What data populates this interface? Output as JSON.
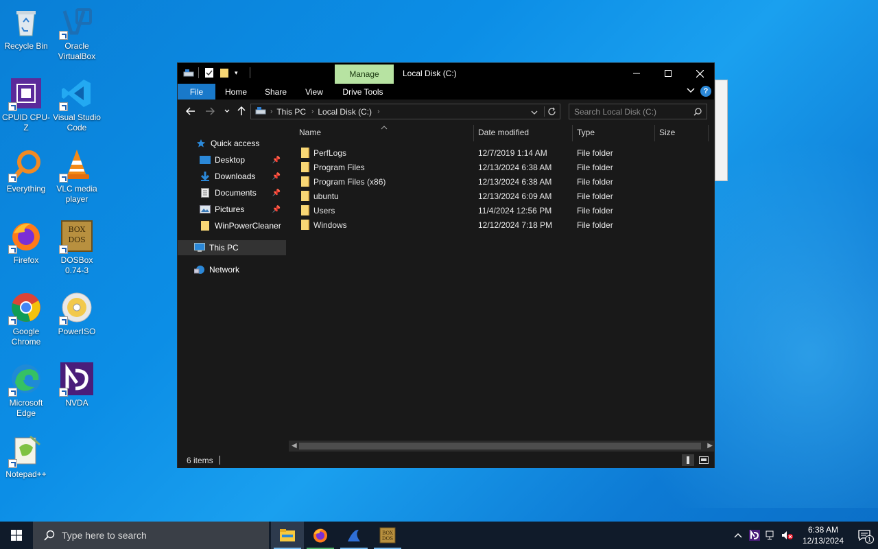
{
  "desktop": {
    "icons": [
      {
        "label": "Recycle Bin"
      },
      {
        "label": "Oracle VirtualBox"
      },
      {
        "label": "CPUID CPU-Z"
      },
      {
        "label": "Visual Studio Code"
      },
      {
        "label": "Everything"
      },
      {
        "label": "VLC media player"
      },
      {
        "label": "Firefox"
      },
      {
        "label": "DOSBox 0.74-3"
      },
      {
        "label": "Google Chrome"
      },
      {
        "label": "PowerISO"
      },
      {
        "label": "Microsoft Edge"
      },
      {
        "label": "NVDA"
      },
      {
        "label": "Notepad++"
      }
    ]
  },
  "window": {
    "title": "Local Disk (C:)",
    "manage_tab": "Manage",
    "ribbon_tabs": [
      "File",
      "Home",
      "Share",
      "View",
      "Drive Tools"
    ],
    "address": {
      "crumbs": [
        "This PC",
        "Local Disk (C:)"
      ]
    },
    "search_placeholder": "Search Local Disk (C:)",
    "nav": {
      "quick_access": "Quick access",
      "items": [
        "Desktop",
        "Downloads",
        "Documents",
        "Pictures",
        "WinPowerCleaner"
      ],
      "this_pc": "This PC",
      "network": "Network"
    },
    "columns": [
      "Name",
      "Date modified",
      "Type",
      "Size"
    ],
    "files": [
      {
        "name": "PerfLogs",
        "date": "12/7/2019 1:14 AM",
        "type": "File folder"
      },
      {
        "name": "Program Files",
        "date": "12/13/2024 6:38 AM",
        "type": "File folder"
      },
      {
        "name": "Program Files (x86)",
        "date": "12/13/2024 6:38 AM",
        "type": "File folder"
      },
      {
        "name": "ubuntu",
        "date": "12/13/2024 6:09 AM",
        "type": "File folder"
      },
      {
        "name": "Users",
        "date": "11/4/2024 12:56 PM",
        "type": "File folder"
      },
      {
        "name": "Windows",
        "date": "12/12/2024 7:18 PM",
        "type": "File folder"
      }
    ],
    "status": "6 items"
  },
  "taskbar": {
    "search_placeholder": "Type here to search",
    "time": "6:38 AM",
    "date": "12/13/2024",
    "notification_count": "1"
  },
  "colors": {
    "accent": "#1979ca",
    "manage": "#b7e3a2",
    "folder": "#f8d775"
  }
}
